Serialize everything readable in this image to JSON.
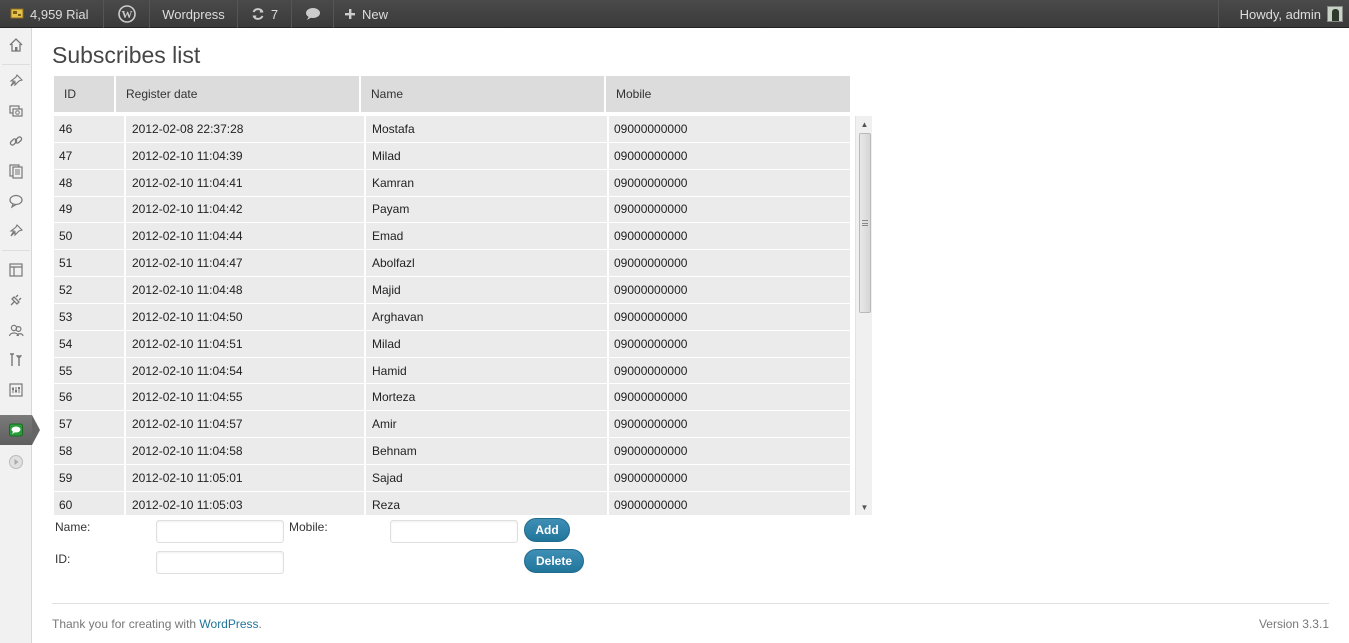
{
  "adminbar": {
    "credit": "4,959 Rial",
    "site_name": "Wordpress",
    "updates_count": "7",
    "new_label": "New",
    "howdy": "Howdy, admin"
  },
  "page": {
    "title": "Subscribes list"
  },
  "table": {
    "columns": [
      "ID",
      "Register date",
      "Name",
      "Mobile"
    ],
    "rows": [
      {
        "id": "46",
        "date": "2012-02-08 22:37:28",
        "name": "Mostafa",
        "mobile": "09000000000"
      },
      {
        "id": "47",
        "date": "2012-02-10 11:04:39",
        "name": "Milad",
        "mobile": "09000000000"
      },
      {
        "id": "48",
        "date": "2012-02-10 11:04:41",
        "name": "Kamran",
        "mobile": "09000000000"
      },
      {
        "id": "49",
        "date": "2012-02-10 11:04:42",
        "name": "Payam",
        "mobile": "09000000000"
      },
      {
        "id": "50",
        "date": "2012-02-10 11:04:44",
        "name": "Emad",
        "mobile": "09000000000"
      },
      {
        "id": "51",
        "date": "2012-02-10 11:04:47",
        "name": "Abolfazl",
        "mobile": "09000000000"
      },
      {
        "id": "52",
        "date": "2012-02-10 11:04:48",
        "name": "Majid",
        "mobile": "09000000000"
      },
      {
        "id": "53",
        "date": "2012-02-10 11:04:50",
        "name": "Arghavan",
        "mobile": "09000000000"
      },
      {
        "id": "54",
        "date": "2012-02-10 11:04:51",
        "name": "Milad",
        "mobile": "09000000000"
      },
      {
        "id": "55",
        "date": "2012-02-10 11:04:54",
        "name": "Hamid",
        "mobile": "09000000000"
      },
      {
        "id": "56",
        "date": "2012-02-10 11:04:55",
        "name": "Morteza",
        "mobile": "09000000000"
      },
      {
        "id": "57",
        "date": "2012-02-10 11:04:57",
        "name": "Amir",
        "mobile": "09000000000"
      },
      {
        "id": "58",
        "date": "2012-02-10 11:04:58",
        "name": "Behnam",
        "mobile": "09000000000"
      },
      {
        "id": "59",
        "date": "2012-02-10 11:05:01",
        "name": "Sajad",
        "mobile": "09000000000"
      },
      {
        "id": "60",
        "date": "2012-02-10 11:05:03",
        "name": "Reza",
        "mobile": "09000000000"
      }
    ]
  },
  "form": {
    "name_label": "Name:",
    "mobile_label": "Mobile:",
    "id_label": "ID:",
    "name_value": "",
    "mobile_value": "",
    "id_value": "",
    "add_label": "Add",
    "delete_label": "Delete"
  },
  "footer": {
    "thanks_prefix": "Thank you for creating with ",
    "thanks_link": "WordPress",
    "thanks_suffix": ".",
    "version": "Version 3.3.1"
  },
  "menu_icons": [
    "dashboard-icon",
    "posts-icon",
    "media-icon",
    "links-icon",
    "pages-icon",
    "comments-icon",
    "pin-icon",
    "appearance-icon",
    "plugins-icon",
    "users-icon",
    "tools-icon",
    "settings-icon",
    "sms-plugin-icon",
    "collapse-icon"
  ],
  "colors": {
    "adminbar_bg": "#464646",
    "button_blue": "#21759b",
    "header_cell": "#dcdcdc",
    "body_cell": "#ebebeb",
    "link": "#21759b"
  }
}
